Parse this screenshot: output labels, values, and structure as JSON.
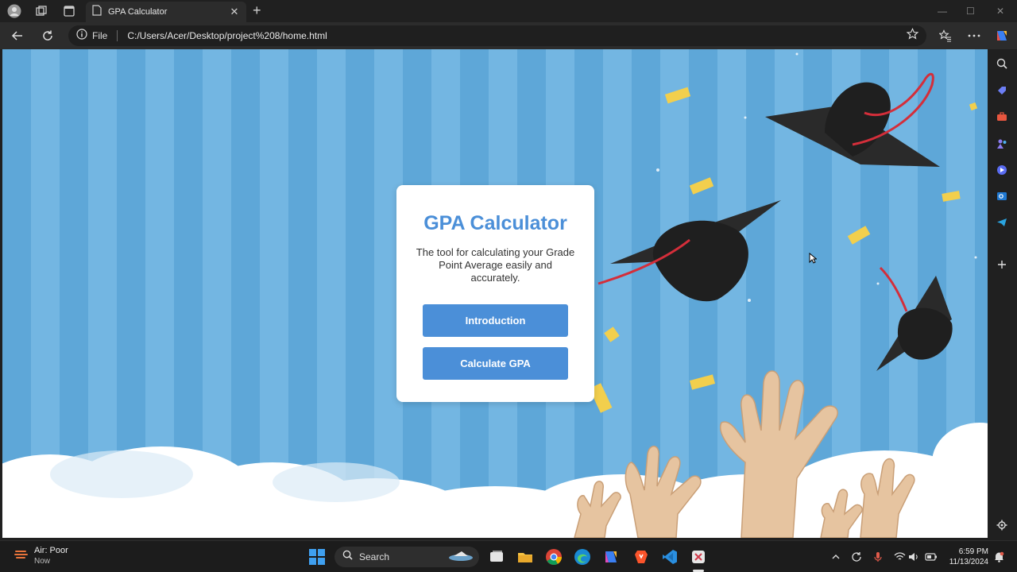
{
  "browser": {
    "tab_title": "GPA Calculator",
    "tab_close": "✕",
    "new_tab": "+",
    "address_scheme": "File",
    "address_url": "C:/Users/Acer/Desktop/project%208/home.html"
  },
  "page": {
    "title": "GPA Calculator",
    "description": "The tool for calculating your Grade Point Average easily and accurately.",
    "buttons": {
      "introduction": "Introduction",
      "calculate": "Calculate GPA"
    }
  },
  "taskbar": {
    "weather_status": "Air: Poor",
    "weather_time": "Now",
    "search_label": "Search",
    "time": "6:59 PM",
    "date": "11/13/2024"
  },
  "colors": {
    "accent": "#4b8fd8",
    "stripe_dark": "#5ea7d8",
    "stripe_light": "#73b6e2",
    "card_bg": "#ffffff"
  },
  "icons": {
    "profile": "profile-icon",
    "workspaces": "workspaces-icon",
    "tab_actions": "tab-actions-icon",
    "back": "back-arrow-icon",
    "refresh": "refresh-icon",
    "info": "info-icon",
    "favorite": "star-icon",
    "favorites": "favorites-icon",
    "more": "more-icon",
    "copilot": "copilot-icon"
  }
}
